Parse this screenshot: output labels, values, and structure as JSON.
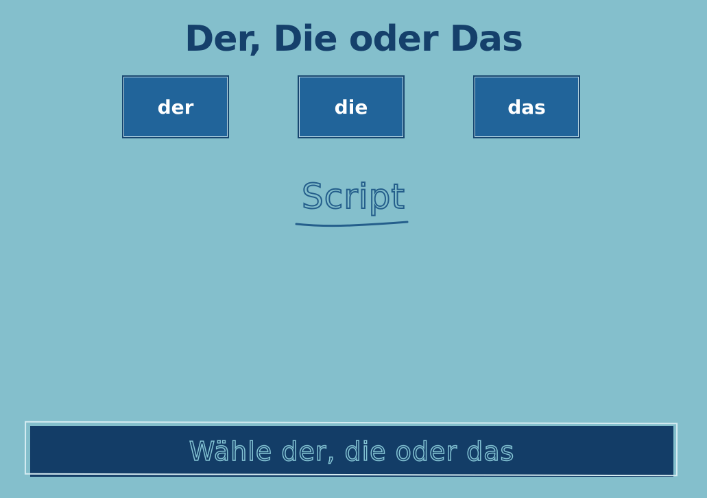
{
  "title": "Der, Die oder Das",
  "buttons": {
    "der": "der",
    "die": "die",
    "das": "das"
  },
  "current_word": "Script",
  "feedback": "Wähle der, die oder das",
  "colors": {
    "background": "#84bfcc",
    "title": "#15406b",
    "button": "#21649a",
    "feedback_bar": "#133d67"
  }
}
